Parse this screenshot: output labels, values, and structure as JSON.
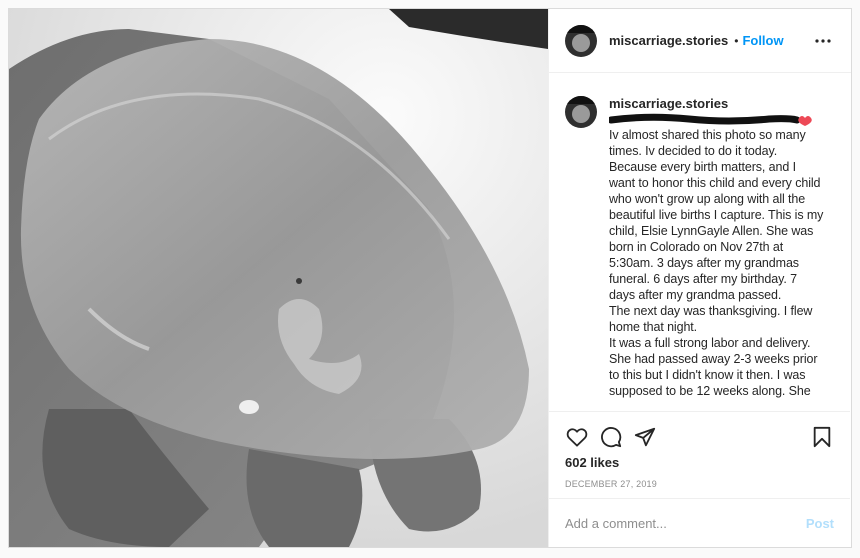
{
  "header": {
    "username": "miscarriage.stories",
    "separator": "•",
    "follow_label": "Follow",
    "more_icon": "more-dots-icon"
  },
  "comment": {
    "username": "miscarriage.stories",
    "caption": "Iv almost shared this photo so many times. Iv decided to do it today. Because every birth matters, and I want to honor this child and every child who won't grow up along with all the beautiful live births I capture. This is my child, Elsie LynnGayle Allen. She was born in Colorado on Nov 27th at 5:30am. 3 days after my grandmas funeral. 6 days after my birthday. 7 days after my grandma passed.\nThe next day was thanksgiving. I flew home that night.\nIt was a full strong labor and delivery. She had passed away 2-3 weeks prior to this but I didn't know it then. I was supposed to be 12 weeks along. She"
  },
  "actions": {
    "like_icon": "heart-icon",
    "comment_icon": "comment-bubble-icon",
    "share_icon": "paper-plane-icon",
    "save_icon": "bookmark-icon"
  },
  "likes_text": "602 likes",
  "date_text": "DECEMBER 27, 2019",
  "add_comment": {
    "placeholder": "Add a comment...",
    "post_label": "Post"
  },
  "colors": {
    "follow": "#0095f6",
    "post_disabled": "#b2dffc",
    "heart_emoji": "#ed4956"
  }
}
